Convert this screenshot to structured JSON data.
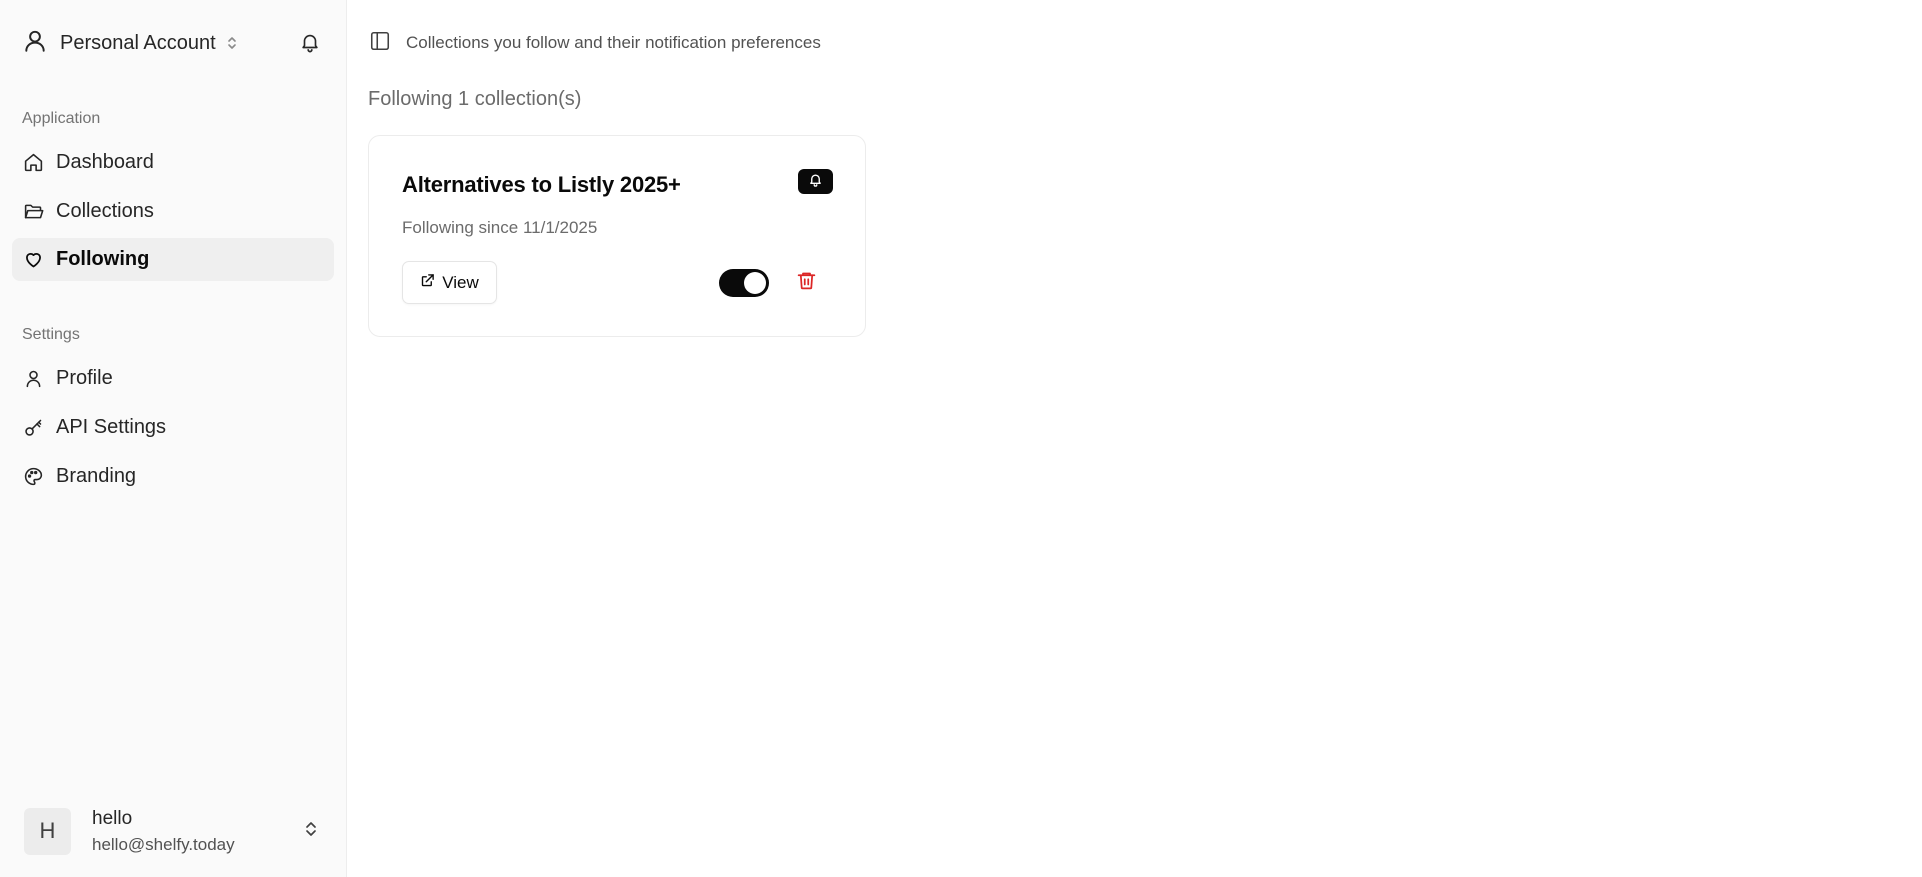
{
  "account": {
    "label": "Personal Account",
    "icon": "user-icon"
  },
  "sidebar": {
    "sections": [
      {
        "label": "Application",
        "items": [
          {
            "label": "Dashboard",
            "icon": "home-icon"
          },
          {
            "label": "Collections",
            "icon": "folder-open-icon"
          },
          {
            "label": "Following",
            "icon": "heart-icon",
            "active": true
          }
        ]
      },
      {
        "label": "Settings",
        "items": [
          {
            "label": "Profile",
            "icon": "user-icon"
          },
          {
            "label": "API Settings",
            "icon": "key-icon"
          },
          {
            "label": "Branding",
            "icon": "palette-icon"
          }
        ]
      }
    ]
  },
  "user": {
    "initial": "H",
    "name": "hello",
    "email": "hello@shelfy.today"
  },
  "header": {
    "description": "Collections you follow and their notification preferences"
  },
  "main": {
    "count_text": "Following 1 collection(s)",
    "cards": [
      {
        "title": "Alternatives to Listly 2025+",
        "subtitle": "Following since 11/1/2025",
        "view_label": "View",
        "notifications_enabled": true
      }
    ]
  },
  "colors": {
    "accent": "#0a0a0a",
    "danger": "#dc2626",
    "sidebar_bg": "#fafafa",
    "active_bg": "#efefef"
  }
}
